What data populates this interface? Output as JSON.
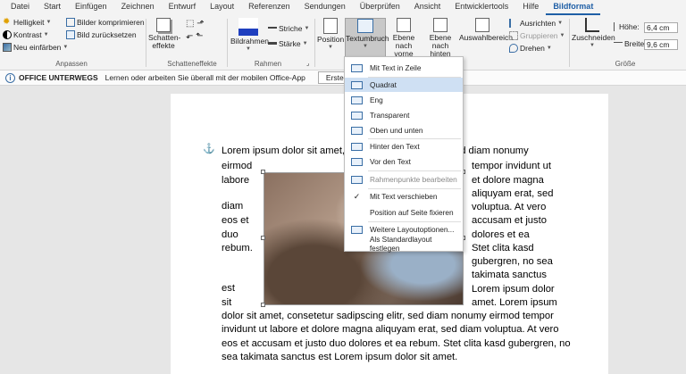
{
  "tabs": [
    "Datei",
    "Start",
    "Einfügen",
    "Zeichnen",
    "Entwurf",
    "Layout",
    "Referenzen",
    "Sendungen",
    "Überprüfen",
    "Ansicht",
    "Entwicklertools",
    "Hilfe",
    "Bildformat"
  ],
  "ribbon": {
    "anpassen": {
      "helligkeit": "Helligkeit",
      "kontrast": "Kontrast",
      "neu_einfaerben": "Neu einfärben",
      "bilder_komprimieren": "Bilder komprimieren",
      "bild_zuruecksetzen": "Bild zurücksetzen",
      "label": "Anpassen"
    },
    "schatteneffekte": {
      "schatteneffekte_btn_line1": "Schatten-",
      "schatteneffekte_btn_line2": "effekte",
      "label": "Schatteneffekte"
    },
    "rahmen": {
      "bildrahmen": "Bildrahmen",
      "striche": "Striche",
      "staerke": "Stärke",
      "label": "Rahmen"
    },
    "anordnen": {
      "position": "Position",
      "textumbruch": "Textumbruch",
      "ebene_vorne_l1": "Ebene nach",
      "ebene_vorne_l2": "vorne",
      "ebene_hinten_l1": "Ebene nach",
      "ebene_hinten_l2": "hinten",
      "auswahlbereich": "Auswahlbereich",
      "ausrichten": "Ausrichten",
      "gruppieren": "Gruppieren",
      "drehen": "Drehen"
    },
    "groesse": {
      "zuschneiden": "Zuschneiden",
      "hoehe_label": "Höhe:",
      "hoehe_value": "6,4 cm",
      "breite_label": "Breite:",
      "breite_value": "9,6 cm",
      "label": "Größe"
    }
  },
  "infobar": {
    "title": "OFFICE UNTERWEGS",
    "message": "Lernen oder arbeiten Sie überall mit der mobilen Office-App",
    "button": "Erste Schritte"
  },
  "menu": {
    "items": [
      "Mit Text in Zeile",
      "Quadrat",
      "Eng",
      "Transparent",
      "Oben und unten",
      "Hinter den Text",
      "Vor den Text",
      "Rahmenpunkte bearbeiten",
      "Mit Text verschieben",
      "Position auf Seite fixieren",
      "Weitere Layoutoptionen...",
      "Als Standardlayout festlegen"
    ],
    "check_mark": "✓"
  },
  "document": {
    "lines_full_top": "Lorem ipsum dolor sit amet, c",
    "line1_right": "ed diam nonumy",
    "left": [
      "eirmod",
      "labore",
      "diam",
      "eos et",
      "duo",
      "rebum.",
      "est",
      "sit"
    ],
    "right": [
      "tempor invidunt ut",
      "et dolore magna",
      "aliquyam erat, sed",
      "voluptua.  At vero",
      "accusam et justo",
      "dolores et ea",
      "Stet clita kasd",
      "gubergren, no sea",
      "takimata sanctus",
      "Lorem ipsum dolor",
      "amet. Lorem ipsum"
    ],
    "bottom": [
      "dolor sit amet, consetetur sadipscing elitr, sed diam nonumy eirmod tempor",
      "invidunt ut labore et dolore magna aliquyam erat, sed diam voluptua. At vero",
      "eos et accusam et justo duo dolores et ea rebum. Stet clita kasd gubergren, no",
      "sea takimata sanctus est Lorem ipsum dolor sit amet."
    ],
    "anchor_symbol": "⚓"
  }
}
